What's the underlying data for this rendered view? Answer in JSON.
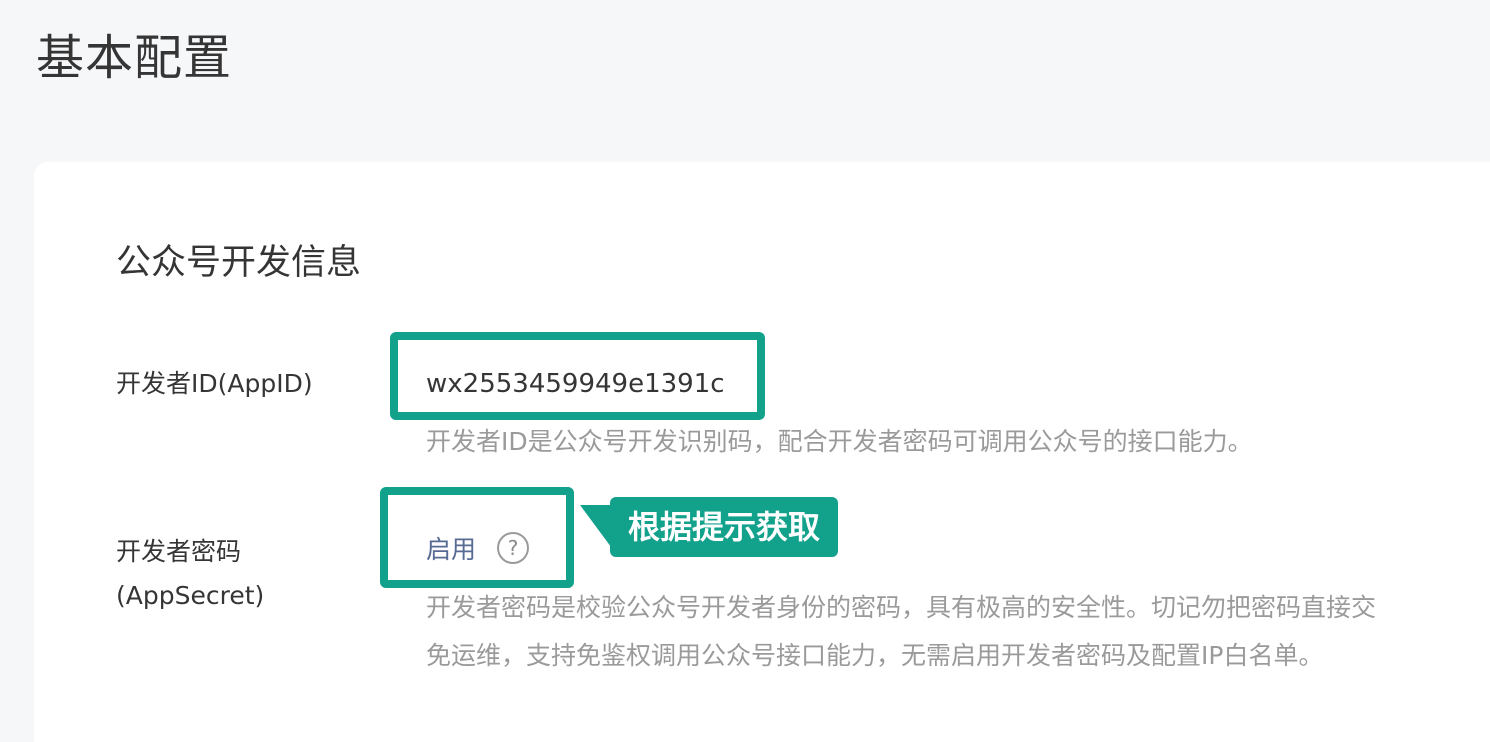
{
  "page": {
    "title": "基本配置"
  },
  "section": {
    "title": "公众号开发信息"
  },
  "appid": {
    "label": "开发者ID(AppID)",
    "value": "wx2553459949e1391c",
    "description": "开发者ID是公众号开发识别码，配合开发者密码可调用公众号的接口能力。"
  },
  "appsecret": {
    "label": "开发者密码(AppSecret)",
    "action_label": "启用",
    "help_icon": "?",
    "description_line1": "开发者密码是校验公众号开发者身份的密码，具有极高的安全性。切记勿把密码直接交",
    "description_line2": "免运维，支持免鉴权调用公众号接口能力，无需启用开发者密码及配置IP白名单。"
  },
  "annotation": {
    "callout_text": "根据提示获取"
  },
  "colors": {
    "highlight": "#12a18b",
    "link": "#576b95",
    "description": "#9a9a9a",
    "background": "#f6f7f9"
  }
}
